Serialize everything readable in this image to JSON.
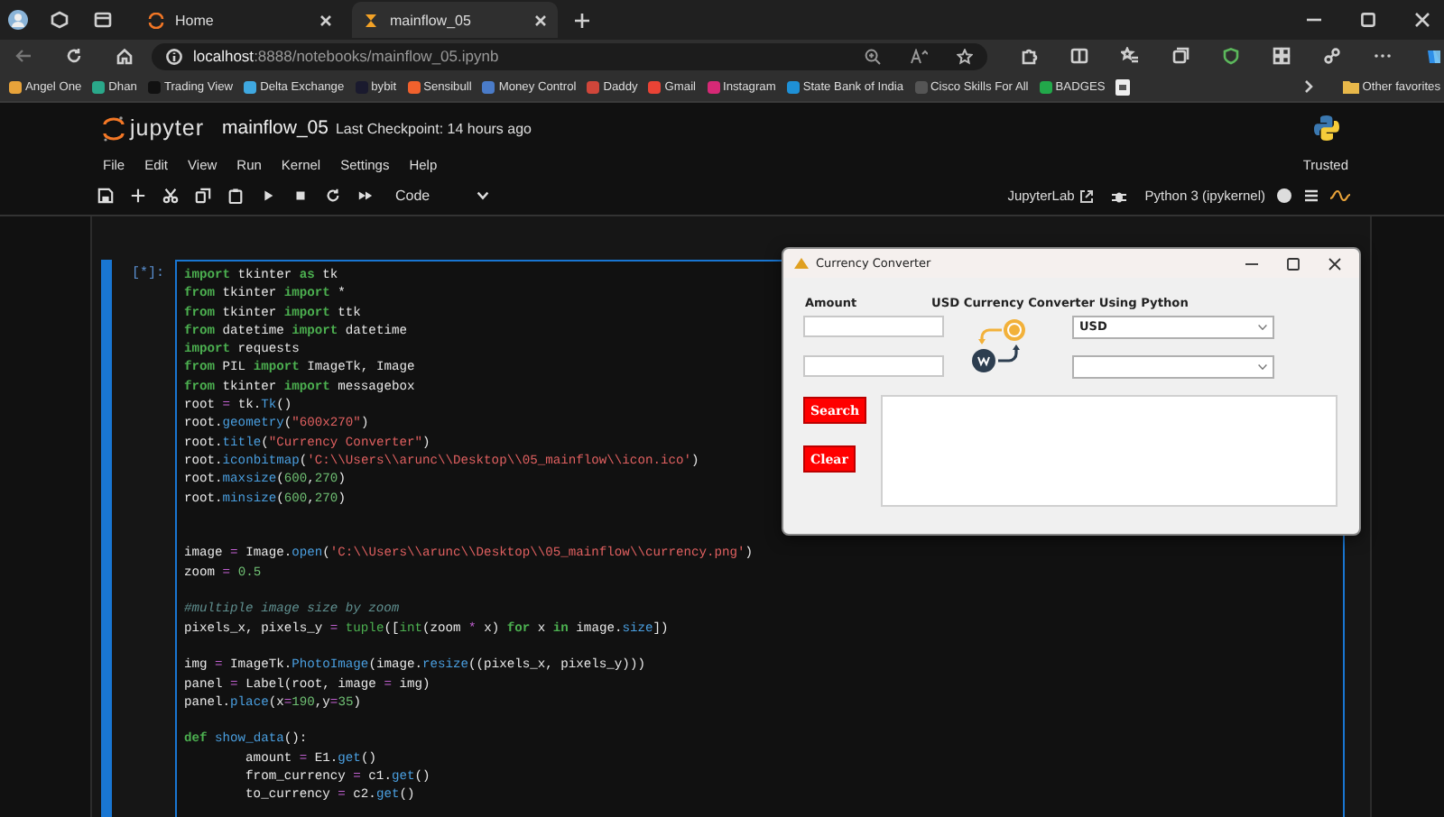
{
  "browser": {
    "tabs": [
      {
        "label": "Home",
        "selected": false
      },
      {
        "label": "mainflow_05",
        "selected": true
      }
    ],
    "address": {
      "host": "localhost",
      "path": ":8888/notebooks/mainflow_05.ipynb"
    },
    "bookmarks": [
      {
        "label": "Angel One",
        "color": "#e8a33a"
      },
      {
        "label": "Dhan",
        "color": "#2aa88a"
      },
      {
        "label": "Trading View",
        "color": "#111111"
      },
      {
        "label": "Delta Exchange",
        "color": "#3fa8e0"
      },
      {
        "label": "bybit",
        "color": "#1a1a2e"
      },
      {
        "label": "Sensibull",
        "color": "#f0612d"
      },
      {
        "label": "Money Control",
        "color": "#4a7bc8"
      },
      {
        "label": "Daddy",
        "color": "#d0463a"
      },
      {
        "label": "Gmail",
        "color": "#ea4335"
      },
      {
        "label": "Instagram",
        "color": "#d62976"
      },
      {
        "label": "State Bank of India",
        "color": "#1e90d6"
      },
      {
        "label": "Cisco Skills For All",
        "color": "#555555"
      },
      {
        "label": "BADGES",
        "color": "#22a84a"
      }
    ],
    "other_favorites": "Other favorites"
  },
  "jupyter": {
    "logo_text": "jupyter",
    "notebook_name": "mainflow_05",
    "checkpoint": "Last Checkpoint: 14 hours ago",
    "menu": [
      "File",
      "Edit",
      "View",
      "Run",
      "Kernel",
      "Settings",
      "Help"
    ],
    "trusted": "Trusted",
    "cell_type": "Code",
    "jupyterlab_link": "JupyterLab",
    "kernel_name": "Python 3 (ipykernel)"
  },
  "cell": {
    "prompt": "[*]:",
    "lines": [
      {
        "kind": "code",
        "tokens": [
          {
            "kind": "kw",
            "text": "import"
          },
          {
            "kind": "plain",
            "text": " tkinter "
          },
          {
            "kind": "kw",
            "text": "as"
          },
          {
            "kind": "plain",
            "text": " tk"
          }
        ]
      },
      {
        "kind": "code",
        "tokens": [
          {
            "kind": "kw",
            "text": "from"
          },
          {
            "kind": "plain",
            "text": " tkinter "
          },
          {
            "kind": "kw",
            "text": "import"
          },
          {
            "kind": "plain",
            "text": " *"
          }
        ]
      },
      {
        "kind": "code",
        "tokens": [
          {
            "kind": "kw",
            "text": "from"
          },
          {
            "kind": "plain",
            "text": " tkinter "
          },
          {
            "kind": "kw",
            "text": "import"
          },
          {
            "kind": "plain",
            "text": " ttk"
          }
        ]
      },
      {
        "kind": "code",
        "tokens": [
          {
            "kind": "kw",
            "text": "from"
          },
          {
            "kind": "plain",
            "text": " datetime "
          },
          {
            "kind": "kw",
            "text": "import"
          },
          {
            "kind": "plain",
            "text": " datetime"
          }
        ]
      },
      {
        "kind": "code",
        "tokens": [
          {
            "kind": "kw",
            "text": "import"
          },
          {
            "kind": "plain",
            "text": " requests"
          }
        ]
      },
      {
        "kind": "code",
        "tokens": [
          {
            "kind": "kw",
            "text": "from"
          },
          {
            "kind": "plain",
            "text": " PIL "
          },
          {
            "kind": "kw",
            "text": "import"
          },
          {
            "kind": "plain",
            "text": " ImageTk, Image"
          }
        ]
      },
      {
        "kind": "code",
        "tokens": [
          {
            "kind": "kw",
            "text": "from"
          },
          {
            "kind": "plain",
            "text": " tkinter "
          },
          {
            "kind": "kw",
            "text": "import"
          },
          {
            "kind": "plain",
            "text": " messagebox"
          }
        ]
      },
      {
        "kind": "code",
        "tokens": [
          {
            "kind": "plain",
            "text": "root "
          },
          {
            "kind": "op",
            "text": "="
          },
          {
            "kind": "plain",
            "text": " tk."
          },
          {
            "kind": "attr",
            "text": "Tk"
          },
          {
            "kind": "plain",
            "text": "()"
          }
        ]
      },
      {
        "kind": "code",
        "tokens": [
          {
            "kind": "plain",
            "text": "root."
          },
          {
            "kind": "attr",
            "text": "geometry"
          },
          {
            "kind": "plain",
            "text": "("
          },
          {
            "kind": "str",
            "text": "\"600x270\""
          },
          {
            "kind": "plain",
            "text": ")"
          }
        ]
      },
      {
        "kind": "code",
        "tokens": [
          {
            "kind": "plain",
            "text": "root."
          },
          {
            "kind": "attr",
            "text": "title"
          },
          {
            "kind": "plain",
            "text": "("
          },
          {
            "kind": "str",
            "text": "\"Currency Converter\""
          },
          {
            "kind": "plain",
            "text": ")"
          }
        ]
      },
      {
        "kind": "code",
        "tokens": [
          {
            "kind": "plain",
            "text": "root."
          },
          {
            "kind": "attr",
            "text": "iconbitmap"
          },
          {
            "kind": "plain",
            "text": "("
          },
          {
            "kind": "str",
            "text": "'C:\\\\Users\\\\arunc\\\\Desktop\\\\05_mainflow\\\\icon.ico'"
          },
          {
            "kind": "plain",
            "text": ")"
          }
        ]
      },
      {
        "kind": "code",
        "tokens": [
          {
            "kind": "plain",
            "text": "root."
          },
          {
            "kind": "attr",
            "text": "maxsize"
          },
          {
            "kind": "plain",
            "text": "("
          },
          {
            "kind": "num",
            "text": "600"
          },
          {
            "kind": "plain",
            "text": ","
          },
          {
            "kind": "num",
            "text": "270"
          },
          {
            "kind": "plain",
            "text": ")"
          }
        ]
      },
      {
        "kind": "code",
        "tokens": [
          {
            "kind": "plain",
            "text": "root."
          },
          {
            "kind": "attr",
            "text": "minsize"
          },
          {
            "kind": "plain",
            "text": "("
          },
          {
            "kind": "num",
            "text": "600"
          },
          {
            "kind": "plain",
            "text": ","
          },
          {
            "kind": "num",
            "text": "270"
          },
          {
            "kind": "plain",
            "text": ")"
          }
        ]
      },
      {
        "kind": "blank"
      },
      {
        "kind": "blank"
      },
      {
        "kind": "code",
        "tokens": [
          {
            "kind": "plain",
            "text": "image "
          },
          {
            "kind": "op",
            "text": "="
          },
          {
            "kind": "plain",
            "text": " Image."
          },
          {
            "kind": "attr",
            "text": "open"
          },
          {
            "kind": "plain",
            "text": "("
          },
          {
            "kind": "str",
            "text": "'C:\\\\Users\\\\arunc\\\\Desktop\\\\05_mainflow\\\\currency.png'"
          },
          {
            "kind": "plain",
            "text": ")"
          }
        ]
      },
      {
        "kind": "code",
        "tokens": [
          {
            "kind": "plain",
            "text": "zoom "
          },
          {
            "kind": "op",
            "text": "="
          },
          {
            "kind": "num",
            "text": " 0.5"
          }
        ]
      },
      {
        "kind": "blank"
      },
      {
        "kind": "code",
        "tokens": [
          {
            "kind": "com",
            "text": "#multiple image size by zoom"
          }
        ]
      },
      {
        "kind": "code",
        "tokens": [
          {
            "kind": "plain",
            "text": "pixels_x, pixels_y "
          },
          {
            "kind": "op",
            "text": "="
          },
          {
            "kind": "bi",
            "text": " tuple"
          },
          {
            "kind": "plain",
            "text": "(["
          },
          {
            "kind": "bi",
            "text": "int"
          },
          {
            "kind": "plain",
            "text": "(zoom "
          },
          {
            "kind": "op",
            "text": "*"
          },
          {
            "kind": "plain",
            "text": " x) "
          },
          {
            "kind": "kw",
            "text": "for"
          },
          {
            "kind": "plain",
            "text": " x "
          },
          {
            "kind": "kw",
            "text": "in"
          },
          {
            "kind": "plain",
            "text": " image."
          },
          {
            "kind": "attr",
            "text": "size"
          },
          {
            "kind": "plain",
            "text": "])"
          }
        ]
      },
      {
        "kind": "blank"
      },
      {
        "kind": "code",
        "tokens": [
          {
            "kind": "plain",
            "text": "img "
          },
          {
            "kind": "op",
            "text": "="
          },
          {
            "kind": "plain",
            "text": " ImageTk."
          },
          {
            "kind": "attr",
            "text": "PhotoImage"
          },
          {
            "kind": "plain",
            "text": "(image."
          },
          {
            "kind": "attr",
            "text": "resize"
          },
          {
            "kind": "plain",
            "text": "((pixels_x, pixels_y)))"
          }
        ]
      },
      {
        "kind": "code",
        "tokens": [
          {
            "kind": "plain",
            "text": "panel "
          },
          {
            "kind": "op",
            "text": "="
          },
          {
            "kind": "plain",
            "text": " Label(root, image "
          },
          {
            "kind": "op",
            "text": "="
          },
          {
            "kind": "plain",
            "text": " img)"
          }
        ]
      },
      {
        "kind": "code",
        "tokens": [
          {
            "kind": "plain",
            "text": "panel."
          },
          {
            "kind": "attr",
            "text": "place"
          },
          {
            "kind": "plain",
            "text": "(x"
          },
          {
            "kind": "op",
            "text": "="
          },
          {
            "kind": "num",
            "text": "190"
          },
          {
            "kind": "plain",
            "text": ",y"
          },
          {
            "kind": "op",
            "text": "="
          },
          {
            "kind": "num",
            "text": "35"
          },
          {
            "kind": "plain",
            "text": ")"
          }
        ]
      },
      {
        "kind": "blank"
      },
      {
        "kind": "code",
        "tokens": [
          {
            "kind": "kw",
            "text": "def"
          },
          {
            "kind": "fn",
            "text": " show_data"
          },
          {
            "kind": "plain",
            "text": "():"
          }
        ]
      },
      {
        "kind": "code",
        "tokens": [
          {
            "kind": "plain",
            "text": "        amount "
          },
          {
            "kind": "op",
            "text": "="
          },
          {
            "kind": "plain",
            "text": " E1."
          },
          {
            "kind": "attr",
            "text": "get"
          },
          {
            "kind": "plain",
            "text": "()"
          }
        ]
      },
      {
        "kind": "code",
        "tokens": [
          {
            "kind": "plain",
            "text": "        from_currency "
          },
          {
            "kind": "op",
            "text": "="
          },
          {
            "kind": "plain",
            "text": " c1."
          },
          {
            "kind": "attr",
            "text": "get"
          },
          {
            "kind": "plain",
            "text": "()"
          }
        ]
      },
      {
        "kind": "code",
        "tokens": [
          {
            "kind": "plain",
            "text": "        to_currency "
          },
          {
            "kind": "op",
            "text": "="
          },
          {
            "kind": "plain",
            "text": " c2."
          },
          {
            "kind": "attr",
            "text": "get"
          },
          {
            "kind": "plain",
            "text": "()"
          }
        ]
      }
    ]
  },
  "tk_window": {
    "title": "Currency Converter",
    "amount_label": "Amount",
    "heading": "USD Currency Converter Using Python",
    "from_currency": "USD",
    "buttons": [
      "Search",
      "Clear"
    ]
  }
}
